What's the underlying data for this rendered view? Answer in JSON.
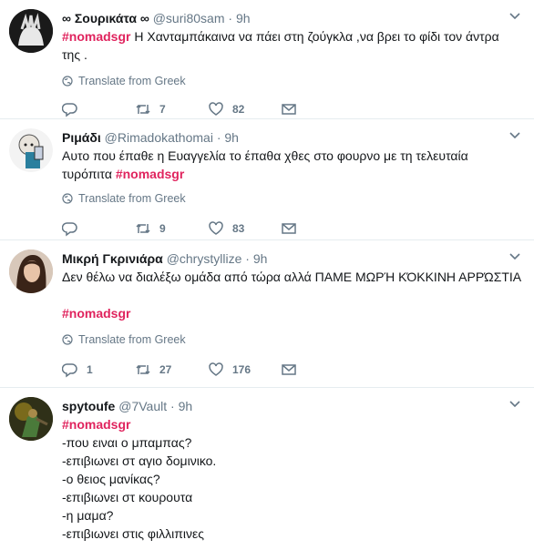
{
  "tweets": [
    {
      "name": "∞ Σουρικάτα ∞",
      "handle": "@suri80sam",
      "time": "9h",
      "hashtag": "#nomadsgr",
      "text": " Η Χανταμπάκαινα να πάει στη ζούγκλα ,να βρει το φίδι τον άντρα",
      "text2": "της .",
      "translate": "Translate from Greek",
      "replies": "",
      "retweets": "7",
      "likes": "82"
    },
    {
      "name": "Ριμάδι",
      "handle": "@Rimadokathomai",
      "time": "9h",
      "text": "Αυτο που έπαθε η Ευαγγελία το έπαθα χθες στο φουρνο με τη τελευταία",
      "text2": "τυρόπιτα ",
      "hashtag": "#nomadsgr",
      "translate": "Translate from Greek",
      "replies": "",
      "retweets": "9",
      "likes": "83"
    },
    {
      "name": "Μικρή Γκρινιάρα",
      "handle": "@chrystyllize",
      "time": "9h",
      "text": "Δεν θέλω να διαλέξω ομάδα από τώρα αλλά ΠΑΜΕ ΜΩΡΉ ΚΌΚΚΙΝΗ ΑΡΡΏΣΤΙΑ",
      "hashtag": "#nomadsgr",
      "translate": "Translate from Greek",
      "replies": "1",
      "retweets": "27",
      "likes": "176"
    },
    {
      "name": "spytoufe",
      "handle": "@7Vault",
      "time": "9h",
      "hashtag": "#nomadsgr",
      "lines": [
        "-που ειναι ο μπαμπας?",
        "-επιβιωνει στ αγιο δομινικο.",
        "-ο θειος μανίκας?",
        "-επιβιωνει στ κουρουτα",
        "-η μαμα?",
        "-επιβιωνει στις φιλλιπινες"
      ]
    }
  ],
  "colors": {
    "hashtag": "#e0245e",
    "muted": "#657786",
    "border": "#e6ecf0"
  },
  "icons": [
    "reply-icon",
    "retweet-icon",
    "like-icon",
    "message-icon",
    "globe-icon",
    "chevron-down-icon"
  ]
}
